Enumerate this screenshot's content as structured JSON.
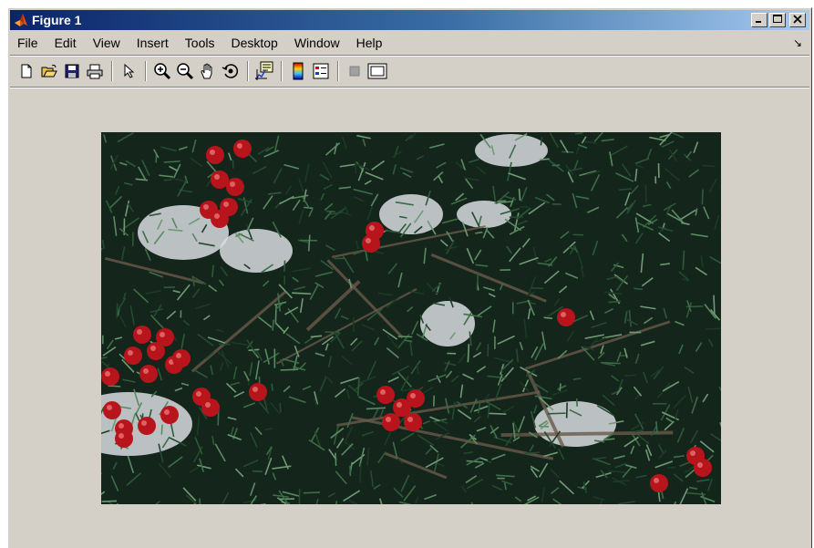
{
  "window": {
    "title": "Figure 1",
    "icon": "matlab-logo-icon",
    "controls": [
      "minimize-icon",
      "maximize-icon",
      "close-icon"
    ]
  },
  "menubar": {
    "items": [
      "File",
      "Edit",
      "View",
      "Insert",
      "Tools",
      "Desktop",
      "Window",
      "Help"
    ],
    "dock_icon": "dock-arrow-icon",
    "dock_glyph": "↘"
  },
  "toolbar": {
    "buttons": [
      {
        "icon": "new-figure-icon"
      },
      {
        "icon": "open-file-icon"
      },
      {
        "icon": "save-figure-icon"
      },
      {
        "icon": "print-figure-icon"
      },
      {
        "icon": "edit-plot-arrow-icon"
      },
      {
        "icon": "zoom-in-icon"
      },
      {
        "icon": "zoom-out-icon"
      },
      {
        "icon": "pan-hand-icon"
      },
      {
        "icon": "rotate-3d-icon"
      },
      {
        "icon": "data-cursor-icon"
      },
      {
        "icon": "insert-colorbar-icon"
      },
      {
        "icon": "insert-legend-icon"
      },
      {
        "icon": "hide-plot-tools-icon"
      },
      {
        "icon": "show-plot-tools-icon"
      }
    ]
  },
  "figure": {
    "content": "image-display",
    "image_subject": "holly-berries-in-snow-image",
    "background_color": "#d4d0c8"
  }
}
